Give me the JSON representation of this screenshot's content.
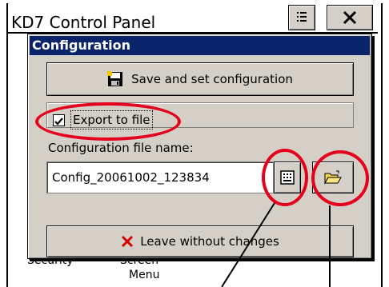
{
  "parent": {
    "title": "KD7 Control Panel",
    "bottom_labels": [
      "Security",
      "Screen"
    ],
    "bottom_label_2": "Menu"
  },
  "dialog": {
    "title": "Configuration",
    "save_button_label": "Save and set configuration",
    "export_checked": true,
    "export_label": "Export to file",
    "file_name_label": "Configuration file name:",
    "file_name_value": "Config_20061002_123834",
    "leave_button_label": "Leave without changes"
  },
  "colors": {
    "title_bar": "#0a246a",
    "dialog_bg": "#d4d0c8",
    "highlight": "#e5001b",
    "leave_icon": "#d40000"
  },
  "icons": [
    "save-disk-icon",
    "keyboard-icon",
    "open-folder-icon",
    "close-x-icon",
    "menu-icon",
    "checkmark-icon"
  ]
}
